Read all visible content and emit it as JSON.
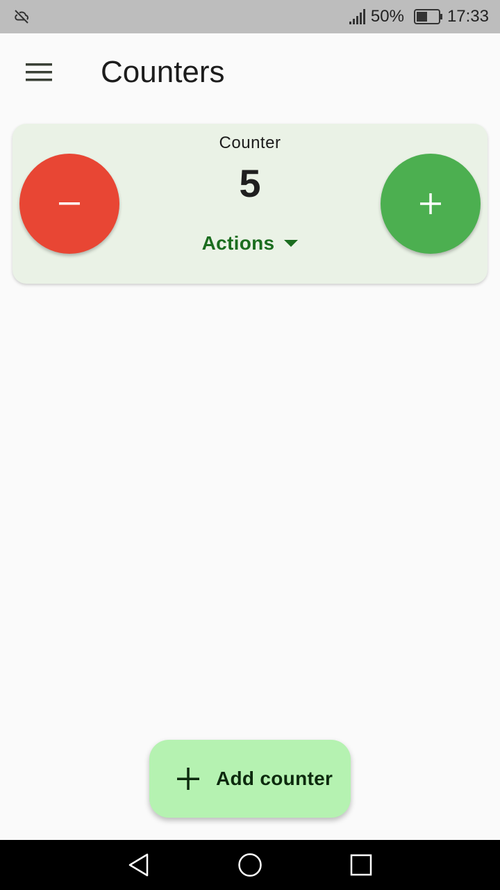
{
  "status_bar": {
    "left_icon": "cloud-off-icon",
    "signal_icon": "signal-icon",
    "battery_percent": "50%",
    "battery_level": 0.5,
    "battery_icon": "battery-icon",
    "time": "17:33"
  },
  "app_bar": {
    "menu_icon": "menu-icon",
    "title": "Counters"
  },
  "counter_card": {
    "label": "Counter",
    "value": "5",
    "decrement_icon": "minus-icon",
    "increment_icon": "plus-icon",
    "actions_label": "Actions",
    "actions_icon": "dropdown-arrow-icon"
  },
  "fab": {
    "label": "Add counter",
    "icon": "plus-icon"
  },
  "nav_bar": {
    "back_icon": "back-icon",
    "home_icon": "home-icon",
    "recents_icon": "recents-icon"
  },
  "colors": {
    "decrement": "#e84634",
    "increment": "#4caf50",
    "card_background": "#eaf2e6",
    "actions_text": "#1b6d1f",
    "fab_background": "#b5f2b1",
    "status_bar": "#bdbdbd",
    "nav_bar": "#000000"
  }
}
